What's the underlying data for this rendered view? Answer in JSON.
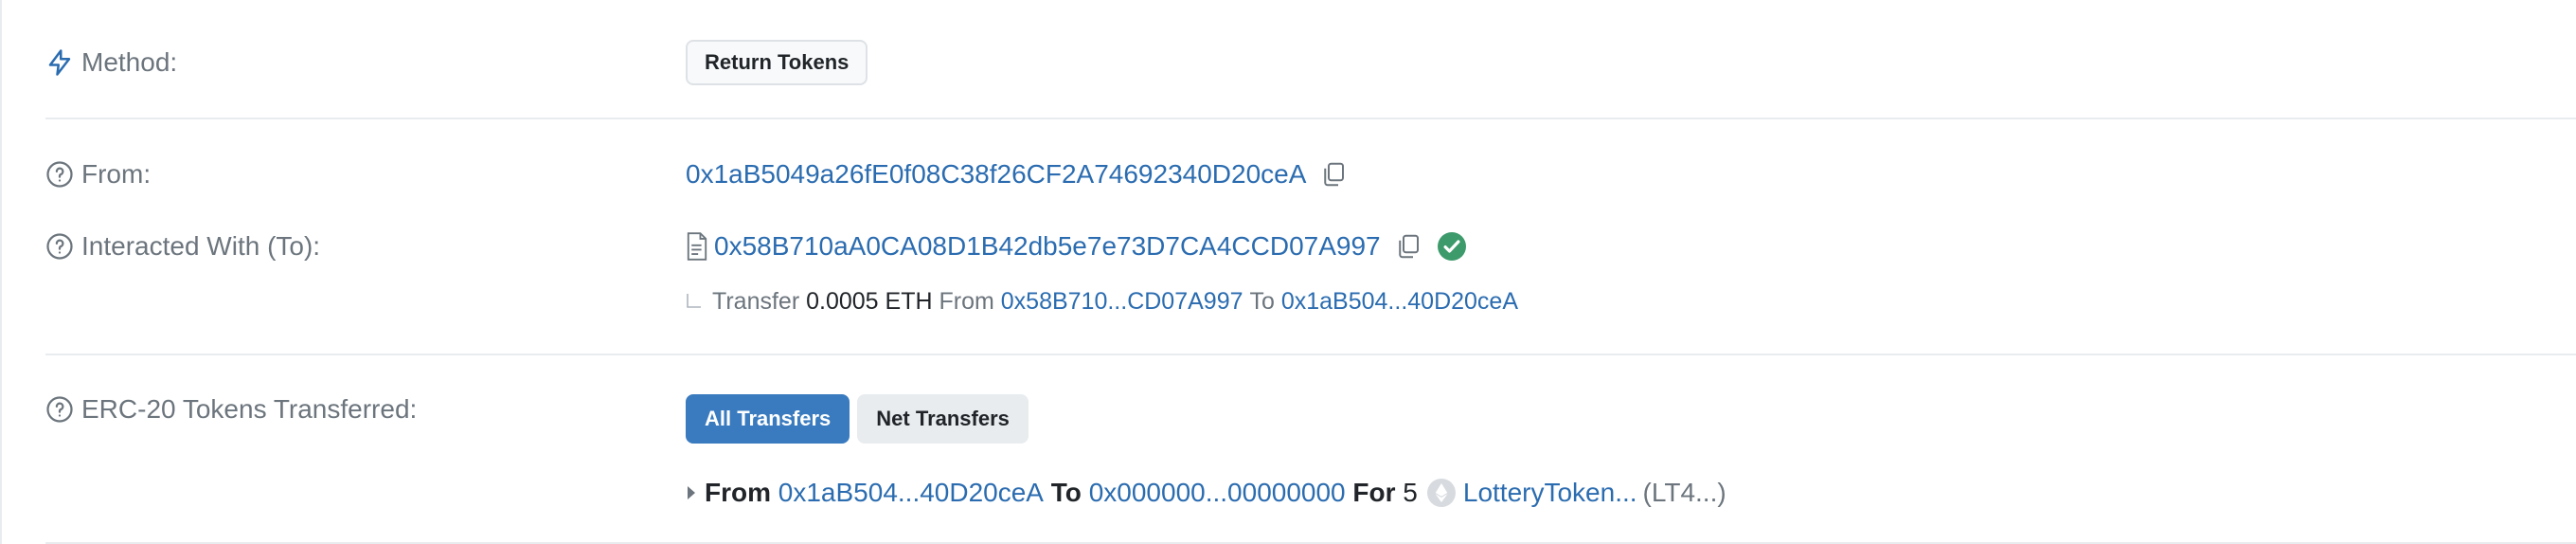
{
  "method": {
    "label": "Method:",
    "button": "Return Tokens",
    "icon": "lightning-icon"
  },
  "from": {
    "label": "From:",
    "address": "0x1aB5049a26fE0f08C38f26CF2A74692340D20ceA",
    "icon": "help-circle-icon"
  },
  "interacted": {
    "label": "Interacted With (To):",
    "address": "0x58B710aA0CA08D1B42db5e7e73D7CA4CCD07A997",
    "verified_color": "#3d9a6b",
    "transfer": {
      "word": "Transfer",
      "amount": "0.0005 ETH",
      "from_word": "From",
      "from_addr": "0x58B710...CD07A997",
      "to_word": "To",
      "to_addr": "0x1aB504...40D20ceA"
    }
  },
  "erc20": {
    "label": "ERC-20 Tokens Transferred:",
    "tabs": [
      "All Transfers",
      "Net Transfers"
    ],
    "active_tab": "All Transfers",
    "transfer": {
      "from_word": "From",
      "from_addr": "0x1aB504...40D20ceA",
      "to_word": "To",
      "to_addr": "0x000000...00000000",
      "for_word": "For",
      "amount": "5",
      "token_name": "LotteryToken...",
      "token_symbol": "(LT4...)"
    }
  },
  "colors": {
    "link": "#2b6cb0",
    "muted": "#6c757d",
    "primary": "#3a7bbf"
  }
}
